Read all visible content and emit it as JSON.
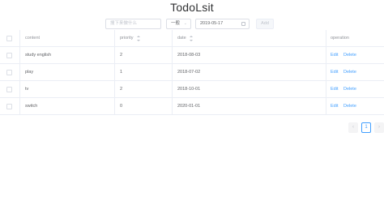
{
  "app": {
    "title": "TodoLsit"
  },
  "toolbar": {
    "todo_placeholder": "搜下来做什么",
    "priority_select": "一般",
    "date_value": "2019-05-17",
    "add_label": "Add"
  },
  "table": {
    "headers": {
      "content": "content",
      "priority": "priority",
      "date": "date",
      "operation": "operation"
    },
    "rows": [
      {
        "content": "study english",
        "priority": "2",
        "date": "2018-08-03",
        "edit": "Edit",
        "delete": "Delete"
      },
      {
        "content": "play",
        "priority": "1",
        "date": "2018-07-02",
        "edit": "Edit",
        "delete": "Delete"
      },
      {
        "content": "tv",
        "priority": "2",
        "date": "2018-10-01",
        "edit": "Edit",
        "delete": "Delete"
      },
      {
        "content": "switch",
        "priority": "0",
        "date": "2020-01-01",
        "edit": "Edit",
        "delete": "Delete"
      }
    ]
  },
  "pagination": {
    "prev_icon": "chevron-left-icon",
    "current_page": "1",
    "next_icon": "chevron-right-icon"
  },
  "colors": {
    "accent": "#409eff",
    "border": "#ebeef5",
    "muted": "#c0c4cc"
  }
}
